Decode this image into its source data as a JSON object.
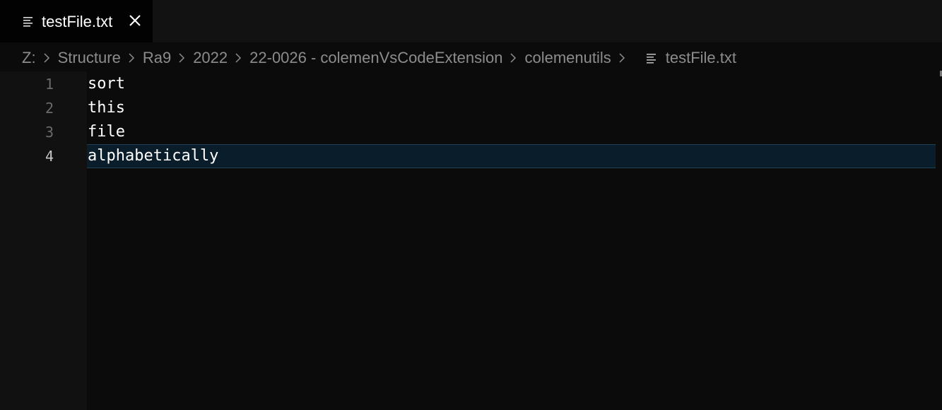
{
  "tab": {
    "label": "testFile.txt",
    "icon": "text-file-icon",
    "close_icon": "close-icon"
  },
  "breadcrumb": {
    "items": [
      "Z:",
      "Structure",
      "Ra9",
      "2022",
      "22-0026 - colemenVsCodeExtension",
      "colemenutils"
    ],
    "file": "testFile.txt",
    "separator_icon": "chevron-right-icon"
  },
  "editor": {
    "line_numbers": [
      "1",
      "2",
      "3",
      "4"
    ],
    "lines": [
      "sort",
      "this",
      "file",
      "alphabetically"
    ],
    "current_line": 4
  },
  "colors": {
    "background": "#0b0b0b",
    "gutter": "#111111",
    "current_line_bg": "#0a1d2a",
    "current_line_border": "#1f4153",
    "text": "#ffffff",
    "muted_text": "#8c8c8c"
  }
}
